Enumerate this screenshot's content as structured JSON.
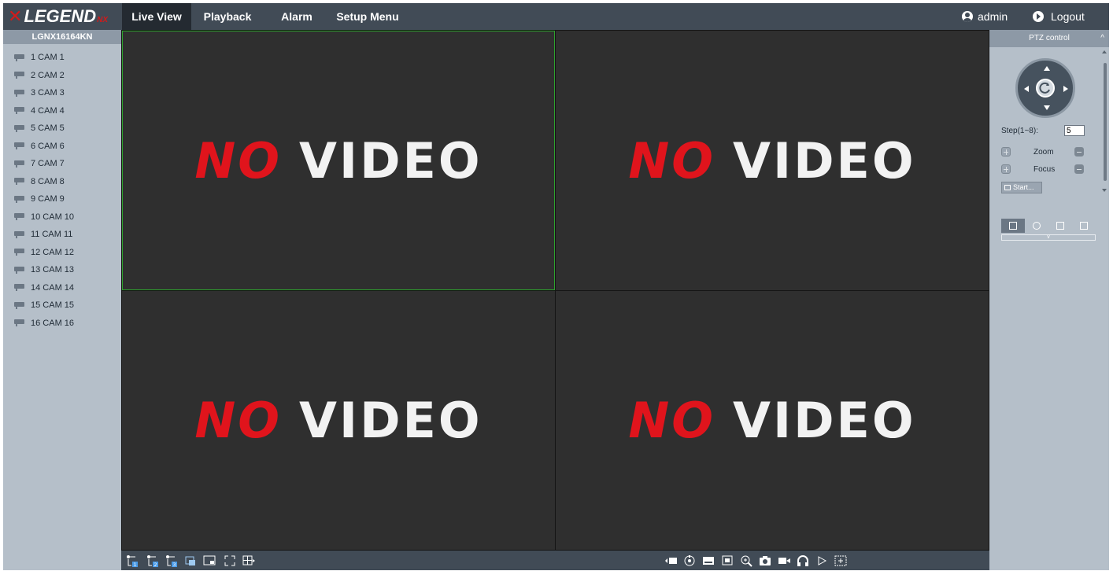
{
  "app": {
    "logo_text": "LEGEND",
    "logo_suffix": "NX"
  },
  "nav": {
    "tabs": [
      {
        "label": "Live View",
        "active": true
      },
      {
        "label": "Playback"
      },
      {
        "label": "Alarm"
      },
      {
        "label": "Setup Menu"
      }
    ],
    "user": "admin",
    "logout": "Logout"
  },
  "device": {
    "name": "LGNX16164KN",
    "cameras": [
      {
        "label": "1 CAM 1"
      },
      {
        "label": "2 CAM 2"
      },
      {
        "label": "3 CAM 3"
      },
      {
        "label": "4 CAM 4"
      },
      {
        "label": "5 CAM 5"
      },
      {
        "label": "6 CAM 6"
      },
      {
        "label": "7 CAM 7"
      },
      {
        "label": "8 CAM 8"
      },
      {
        "label": "9 CAM 9"
      },
      {
        "label": "10 CAM 10"
      },
      {
        "label": "11 CAM 11"
      },
      {
        "label": "12 CAM 12"
      },
      {
        "label": "13 CAM 13"
      },
      {
        "label": "14 CAM 14"
      },
      {
        "label": "15 CAM 15"
      },
      {
        "label": "16 CAM 16"
      }
    ]
  },
  "video": {
    "no_label": "NO",
    "video_label": "VIDEO",
    "active_cell": 1,
    "active_border_color": "#2ea32e"
  },
  "ptz": {
    "title": "PTZ control",
    "step_label": "Step(1~8):",
    "step_value": "5",
    "zoom_label": "Zoom",
    "focus_label": "Focus",
    "start_label": "Start..."
  },
  "toolbar_icons": [
    "stream-1-icon",
    "stream-2-icon",
    "stream-3-icon",
    "snapshot-all-icon",
    "layout-single-icon",
    "fullscreen-icon",
    "grid-layout-icon",
    "prev-icon",
    "monitor-icon",
    "dial-icon",
    "display-icon",
    "screen-capture-icon",
    "zoom-in-icon",
    "camera-icon",
    "record-icon",
    "audio-icon",
    "play-icon",
    "select-region-icon"
  ],
  "colors": {
    "topbar": "#414b56",
    "panel": "#b5bfc9",
    "accent_red": "#e0141c"
  }
}
